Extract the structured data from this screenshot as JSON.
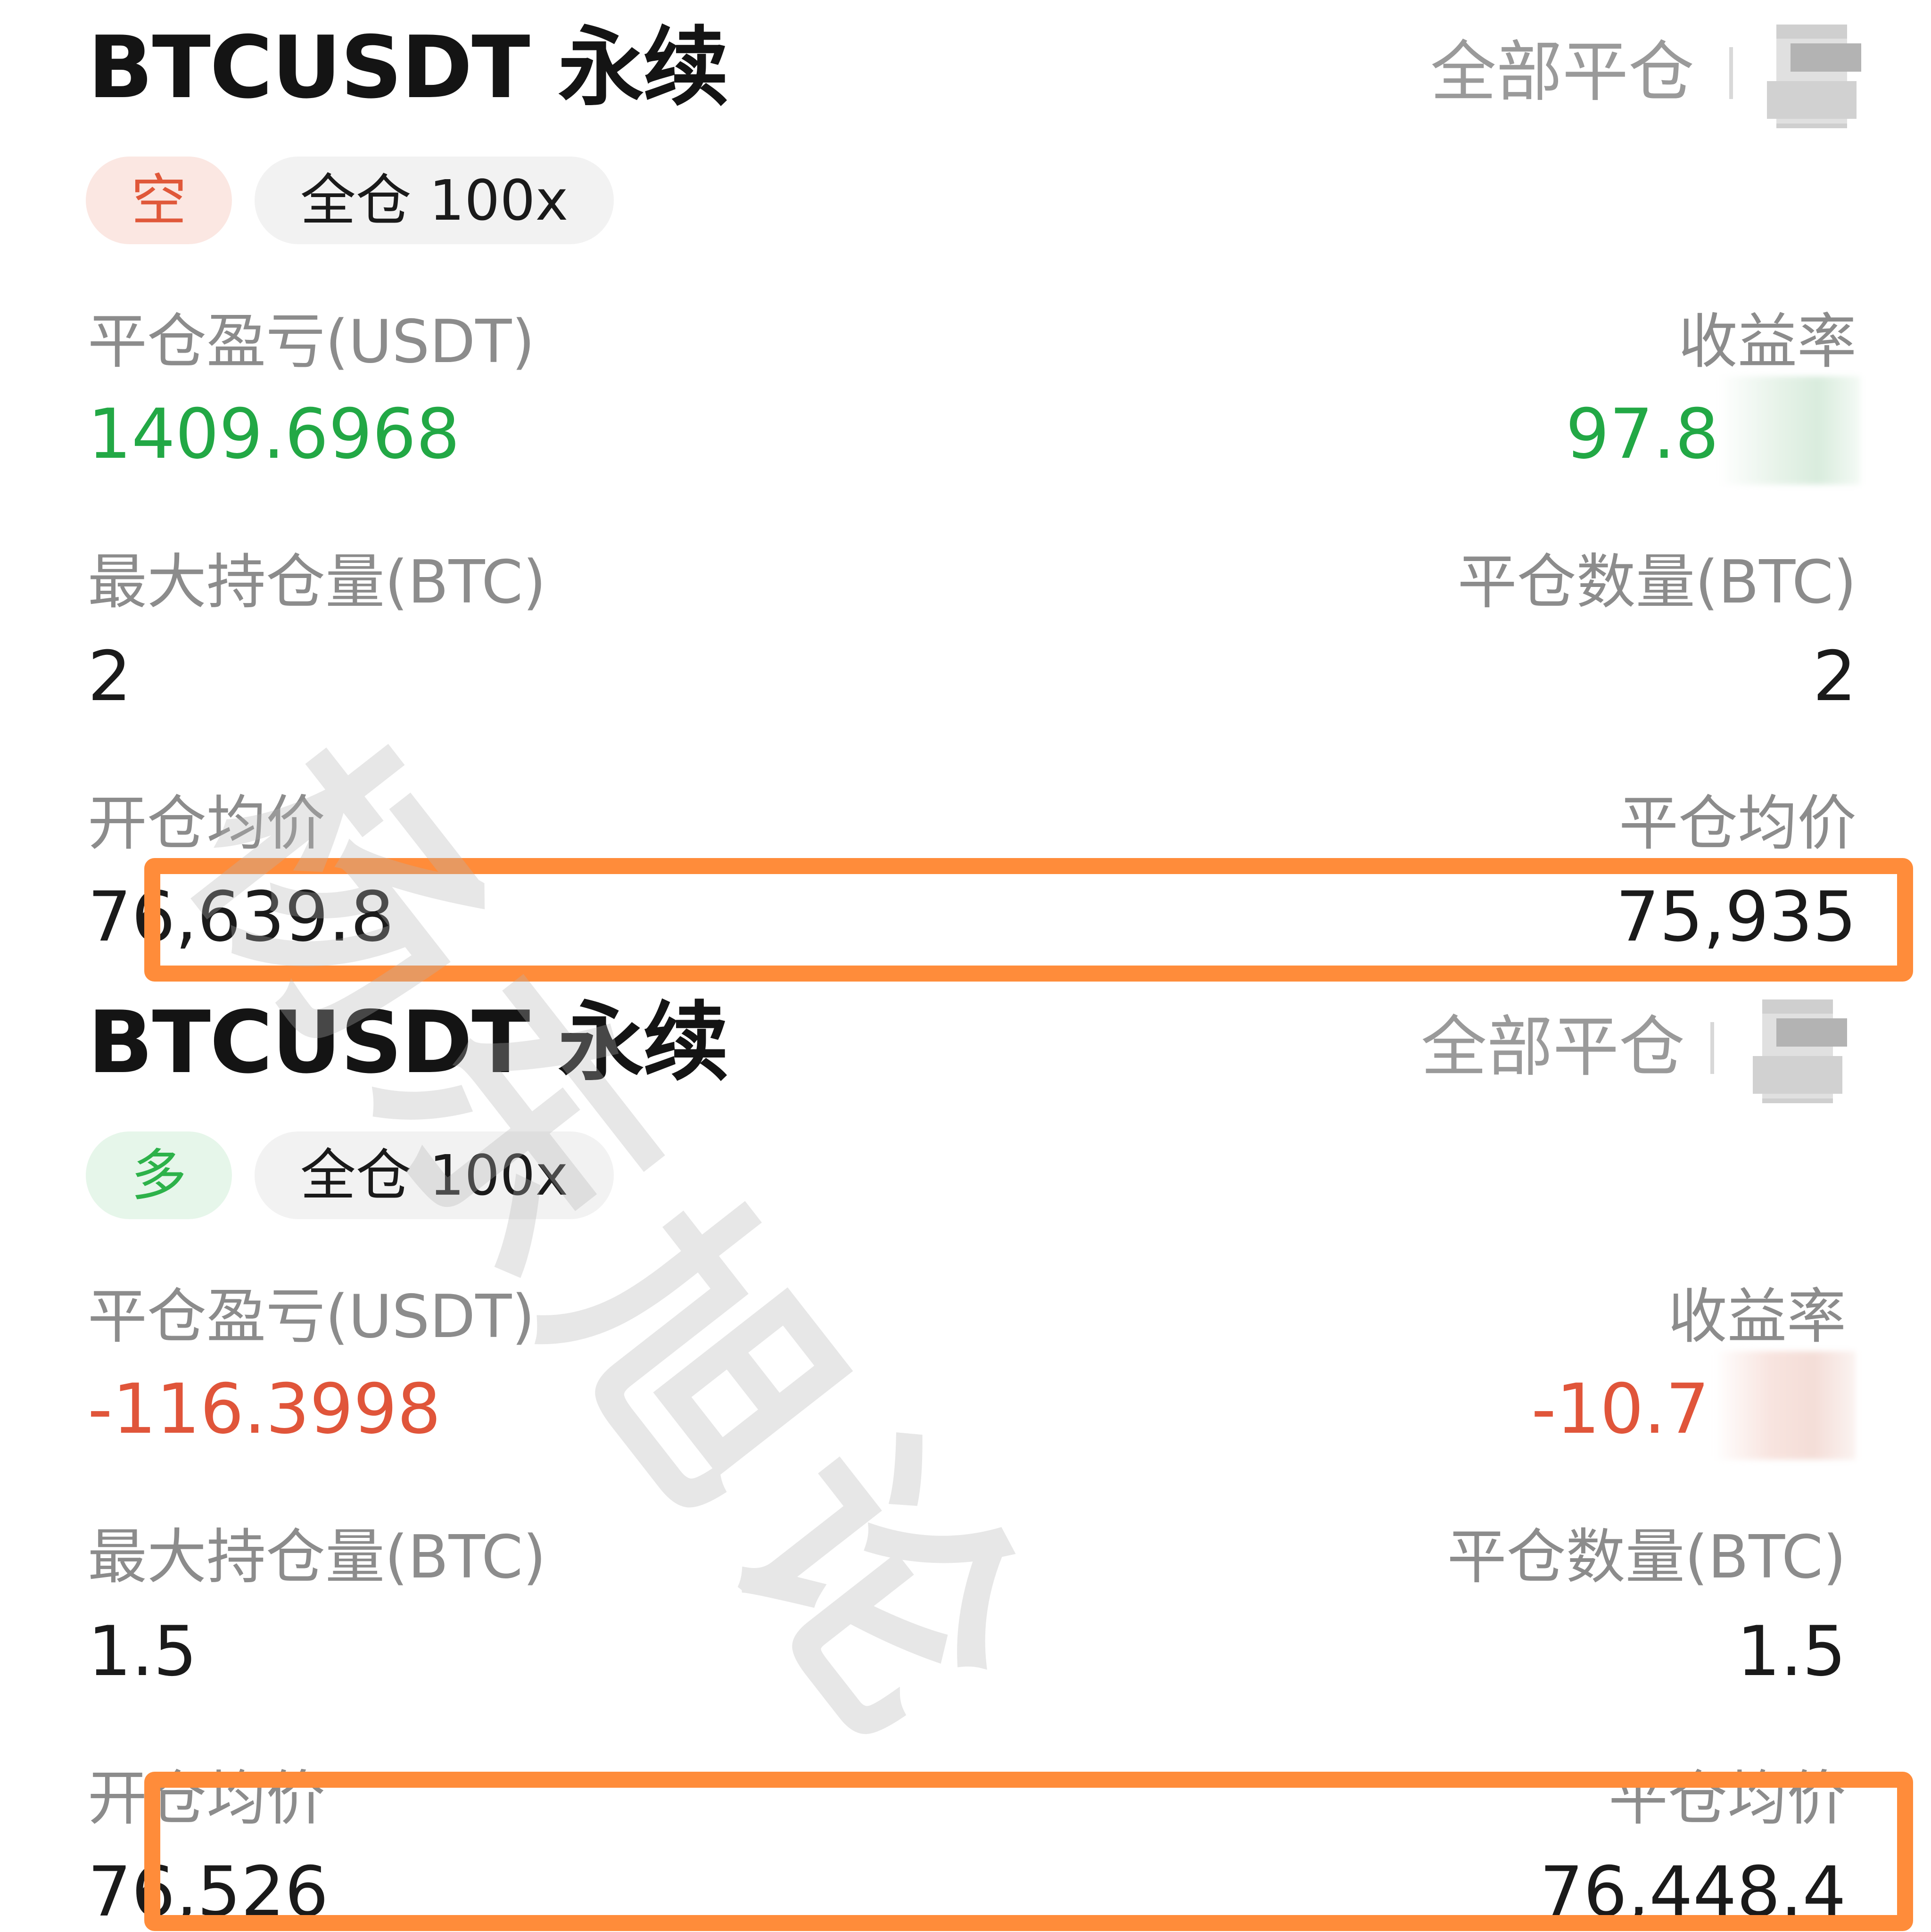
{
  "positions": [
    {
      "title": "BTCUSDT 永续",
      "close_all_label": "全部平仓",
      "side_label": "空",
      "margin_label": "全仓 100x",
      "pnl_label": "平仓盈亏(USDT)",
      "pnl_value": "1409.6968",
      "roi_label": "收益率",
      "roi_value": "97.8",
      "max_position_label": "最大持仓量(BTC)",
      "max_position_value": "2",
      "closed_qty_label": "平仓数量(BTC)",
      "closed_qty_value": "2",
      "open_avg_label": "开仓均价",
      "open_avg_value": "76,639.8",
      "close_avg_label": "平仓均价",
      "close_avg_value": "75,935"
    },
    {
      "title": "BTCUSDT 永续",
      "close_all_label": "全部平仓",
      "side_label": "多",
      "margin_label": "全仓 100x",
      "pnl_label": "平仓盈亏(USDT)",
      "pnl_value": "-116.3998",
      "roi_label": "收益率",
      "roi_value": "-10.7",
      "max_position_label": "最大持仓量(BTC)",
      "max_position_value": "1.5",
      "closed_qty_label": "平仓数量(BTC)",
      "closed_qty_value": "1.5",
      "open_avg_label": "开仓均价",
      "open_avg_value": "76,526",
      "close_avg_label": "平仓均价",
      "close_avg_value": "76,448.4"
    }
  ],
  "watermark": "杨东旭论",
  "colors": {
    "profit": "#22a845",
    "loss": "#e0553a",
    "highlight": "#ff8c3a",
    "muted": "#8c8c8c"
  },
  "icons": [
    "share-icon"
  ]
}
